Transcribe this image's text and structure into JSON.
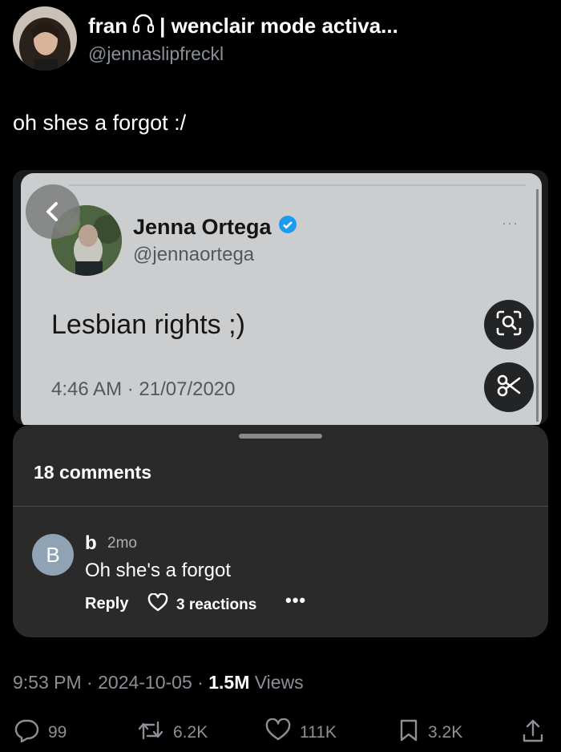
{
  "author": {
    "display_name": "fran",
    "name_suffix": "| wenclair mode activa...",
    "handle": "@jennaslipfreckl",
    "icons": [
      "avatar-photo",
      "headphones-icon"
    ]
  },
  "tweet": {
    "text": "oh shes a forgot :/",
    "time": "9:53 PM",
    "date": "2024-10-05",
    "views_count": "1.5M",
    "views_label": "Views"
  },
  "embedded": {
    "name": "Jenna Ortega",
    "handle": "@jennaortega",
    "text": "Lesbian rights ;)",
    "timestamp": "4:46 AM · 21/07/2020",
    "more": "···",
    "icons": [
      "back-chevron-icon",
      "verified-badge-icon",
      "search-image-icon",
      "scissors-icon"
    ]
  },
  "comments_sheet": {
    "title": "18 comments",
    "comment": {
      "avatar_letter": "B",
      "username": "b",
      "age": "2mo",
      "text": "Oh she's a forgot",
      "reply_label": "Reply",
      "reactions_label": "3 reactions",
      "more": "•••"
    }
  },
  "actions": {
    "replies": "99",
    "reposts": "6.2K",
    "likes": "111K",
    "bookmarks": "3.2K"
  },
  "colors": {
    "background": "#000000",
    "secondary_text": "#8b9096",
    "verified_blue": "#1d9bf0",
    "sheet_bg": "#2a2a2a",
    "comment_avatar": "#8fa3b4"
  }
}
